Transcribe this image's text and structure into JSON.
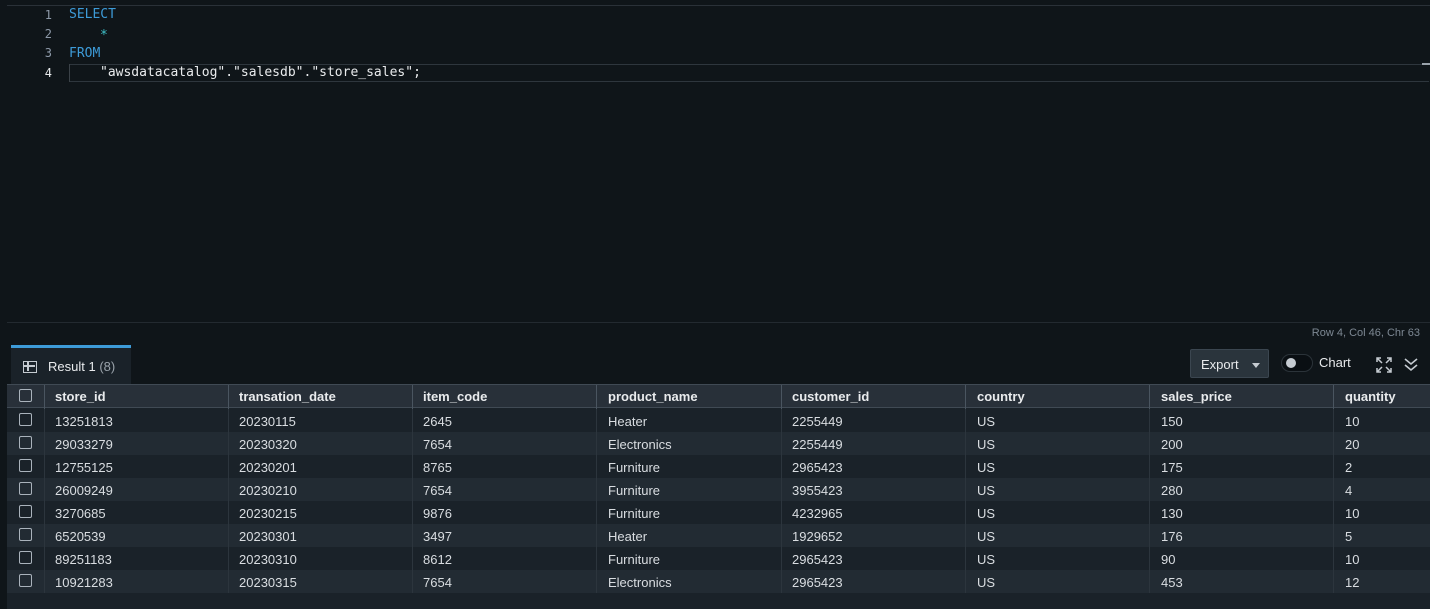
{
  "editor": {
    "lines": [
      {
        "num": "1",
        "text": "SELECT",
        "type": "keyword"
      },
      {
        "num": "2",
        "text": "*",
        "type": "star"
      },
      {
        "num": "3",
        "text": "FROM",
        "type": "keyword"
      },
      {
        "num": "4",
        "text": "\"awsdatacatalog\".\"salesdb\".\"store_sales\";",
        "type": "string"
      }
    ],
    "status": "Row 4,  Col 46,  Chr 63"
  },
  "results": {
    "tab_label": "Result 1",
    "tab_count": "(8)",
    "export_label": "Export",
    "chart_label": "Chart",
    "chart_toggle_on": false
  },
  "table": {
    "columns": [
      "store_id",
      "transation_date",
      "item_code",
      "product_name",
      "customer_id",
      "country",
      "sales_price",
      "quantity"
    ],
    "rows": [
      [
        "13251813",
        "20230115",
        "2645",
        "Heater",
        "2255449",
        "US",
        "150",
        "10"
      ],
      [
        "29033279",
        "20230320",
        "7654",
        "Electronics",
        "2255449",
        "US",
        "200",
        "20"
      ],
      [
        "12755125",
        "20230201",
        "8765",
        "Furniture",
        "2965423",
        "US",
        "175",
        "2"
      ],
      [
        "26009249",
        "20230210",
        "7654",
        "Furniture",
        "3955423",
        "US",
        "280",
        "4"
      ],
      [
        "3270685",
        "20230215",
        "9876",
        "Furniture",
        "4232965",
        "US",
        "130",
        "10"
      ],
      [
        "6520539",
        "20230301",
        "3497",
        "Heater",
        "1929652",
        "US",
        "176",
        "5"
      ],
      [
        "89251183",
        "20230310",
        "8612",
        "Furniture",
        "2965423",
        "US",
        "90",
        "10"
      ],
      [
        "10921283",
        "20230315",
        "7654",
        "Electronics",
        "2965423",
        "US",
        "453",
        "12"
      ]
    ]
  }
}
